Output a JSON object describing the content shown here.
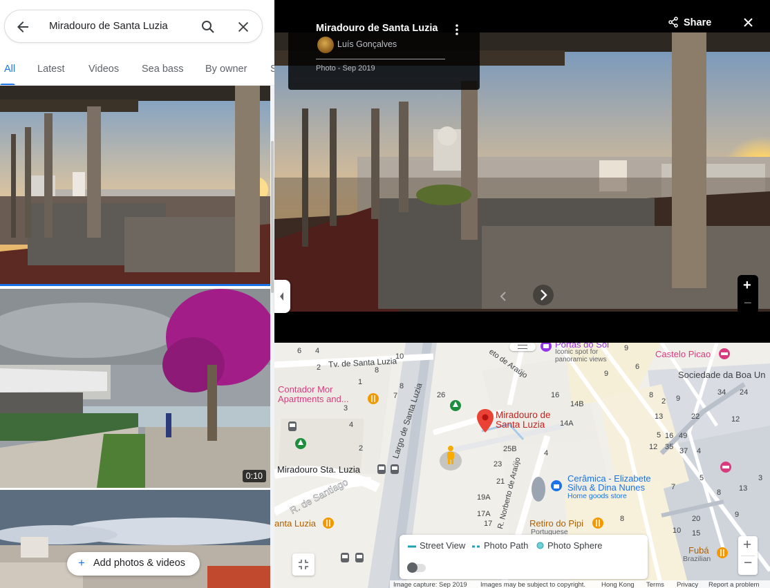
{
  "search": {
    "query": "Miradouro de Santa Luzia"
  },
  "tabs": [
    {
      "label": "All",
      "active": true
    },
    {
      "label": "Latest"
    },
    {
      "label": "Videos"
    },
    {
      "label": "Sea bass"
    },
    {
      "label": "By owner"
    },
    {
      "label": "S"
    }
  ],
  "gallery": {
    "video_duration": "0:10",
    "add_button": "Add photos & videos"
  },
  "viewer": {
    "place_title": "Miradouro de Santa Luzia",
    "author": "Luís Gonçalves",
    "date": "Photo - Sep 2019",
    "share_label": "Share",
    "zoom_in": "+",
    "zoom_out": "−"
  },
  "map": {
    "selected_place": {
      "line1": "Miradouro de",
      "line2": "Santa Luzia"
    },
    "streets": [
      "Tv. de Santa Luzia",
      "Largo de Santa Luzia",
      "R. de Santiago",
      "R. Norberto de Araújo",
      "eto de Araújo"
    ],
    "places": [
      {
        "name": "Portas do Sol",
        "desc_line1": "Iconic spot for",
        "desc_line2": "panoramic views"
      },
      {
        "name": "Castelo Picao"
      },
      {
        "name": "Sociedade da Boa Un"
      },
      {
        "name_line1": "Contador Mor",
        "name_line2": "Apartments and..."
      },
      {
        "name": "Miradouro Sta. Luzia"
      },
      {
        "name_line1": "Cerâmica - Elizabete",
        "name_line2": "Silva & Dina Nunes",
        "desc": "Home goods store"
      },
      {
        "name": "Retiro do Pipi",
        "desc": "Portuguese"
      },
      {
        "name": "anta Luzia"
      },
      {
        "name": "Fubá",
        "desc": "Brazilian"
      }
    ],
    "numbers": [
      "6",
      "4",
      "2",
      "8",
      "10",
      "1",
      "8",
      "7",
      "3",
      "4",
      "2",
      "26",
      "16",
      "14B",
      "14A",
      "9",
      "6",
      "8",
      "9",
      "9",
      "34",
      "24",
      "2",
      "22",
      "12",
      "13",
      "5",
      "16",
      "49",
      "37",
      "4",
      "12",
      "35",
      "25B",
      "4",
      "23",
      "21",
      "19A",
      "17A",
      "17",
      "8",
      "10",
      "20",
      "15",
      "7",
      "8",
      "13",
      "3",
      "5",
      "9"
    ],
    "legend": {
      "street_view": "Street View",
      "photo_path": "Photo Path",
      "photo_sphere": "Photo Sphere"
    },
    "zoom_in": "+",
    "zoom_out": "−",
    "footer": [
      "Image capture: Sep 2019",
      "Images may be subject to copyright.",
      "Hong Kong",
      "Terms",
      "Privacy",
      "Report a problem"
    ]
  },
  "colors": {
    "accent": "#1a73e8",
    "pin_red": "#ea4335",
    "poi_purple": "#9334e6",
    "poi_pink": "#d93c7e",
    "food_orange": "#f29900",
    "park_green": "#1e8e3e"
  }
}
